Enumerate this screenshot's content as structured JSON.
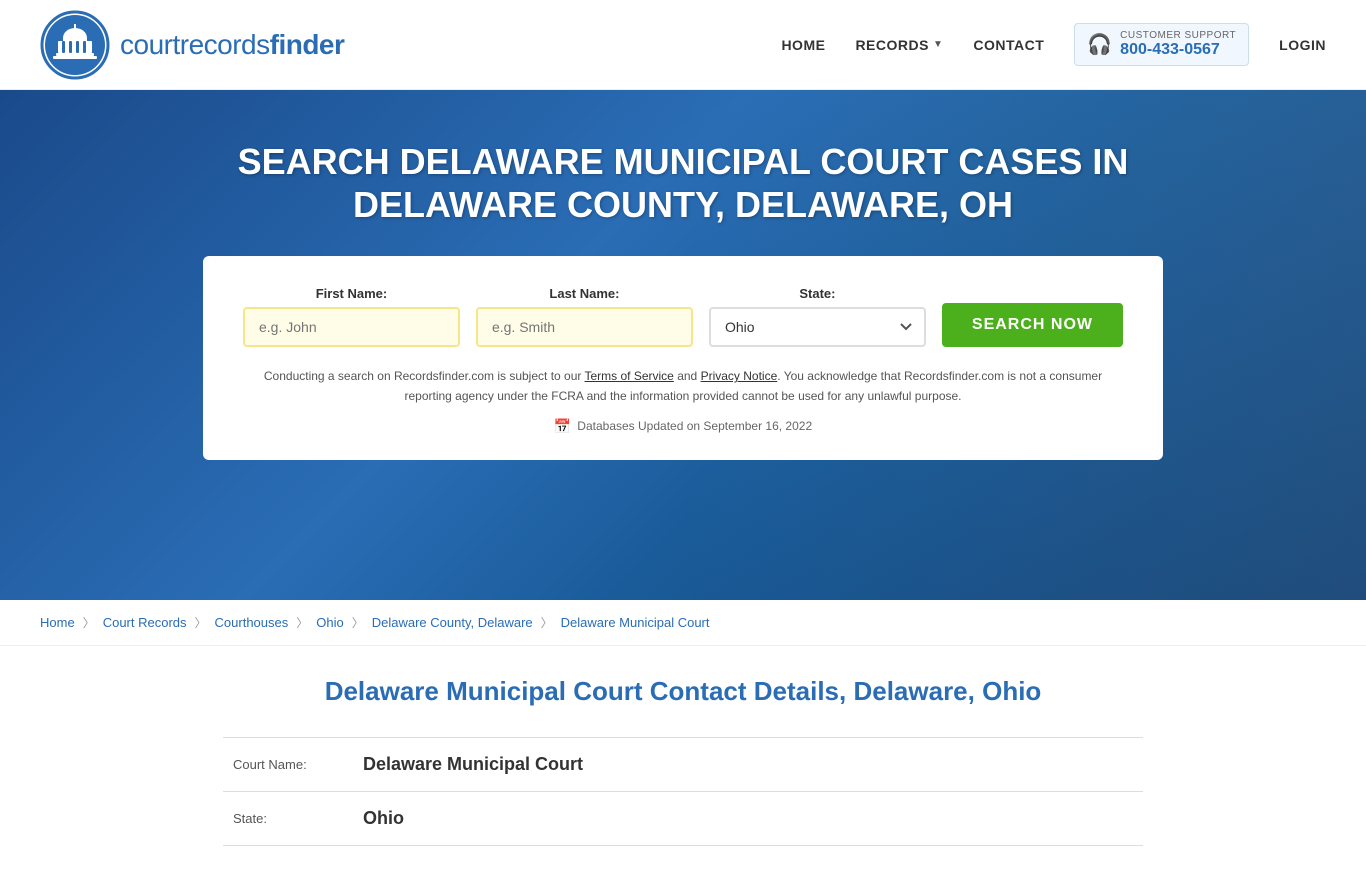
{
  "header": {
    "logo_text_court": "courtrecords",
    "logo_text_finder": "finder",
    "nav": {
      "home": "HOME",
      "records": "RECORDS",
      "contact": "CONTACT",
      "login": "LOGIN"
    },
    "support": {
      "label": "CUSTOMER SUPPORT",
      "number": "800-433-0567"
    }
  },
  "hero": {
    "title": "SEARCH DELAWARE MUNICIPAL COURT CASES IN DELAWARE COUNTY, DELAWARE, OH",
    "form": {
      "first_name_label": "First Name:",
      "first_name_placeholder": "e.g. John",
      "last_name_label": "Last Name:",
      "last_name_placeholder": "e.g. Smith",
      "state_label": "State:",
      "state_value": "Ohio",
      "search_button": "SEARCH NOW"
    },
    "disclaimer": "Conducting a search on Recordsfinder.com is subject to our Terms of Service and Privacy Notice. You acknowledge that Recordsfinder.com is not a consumer reporting agency under the FCRA and the information provided cannot be used for any unlawful purpose.",
    "db_updated": "Databases Updated on September 16, 2022"
  },
  "breadcrumb": {
    "items": [
      {
        "label": "Home",
        "link": true
      },
      {
        "label": "Court Records",
        "link": true
      },
      {
        "label": "Courthouses",
        "link": true
      },
      {
        "label": "Ohio",
        "link": true
      },
      {
        "label": "Delaware County, Delaware",
        "link": true
      },
      {
        "label": "Delaware Municipal Court",
        "link": false
      }
    ]
  },
  "content": {
    "heading": "Delaware Municipal Court Contact Details, Delaware, Ohio",
    "rows": [
      {
        "label": "Court Name:",
        "value": "Delaware Municipal Court"
      },
      {
        "label": "State:",
        "value": "Ohio"
      }
    ]
  }
}
